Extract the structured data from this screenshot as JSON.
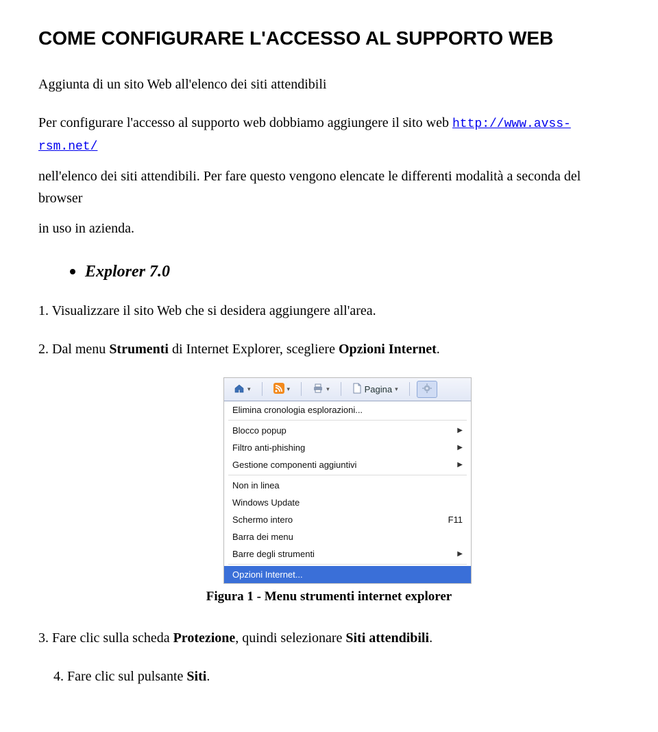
{
  "heading": "COME CONFIGURARE L'ACCESSO AL SUPPORTO WEB",
  "subheading": "Aggiunta di un sito Web all'elenco dei siti attendibili",
  "intro_pre": "Per configurare l'accesso al supporto web dobbiamo aggiungere il sito web ",
  "intro_link": "http://www.avss-rsm.net/",
  "intro_post1": "nell'elenco dei siti attendibili. Per fare questo vengono elencate le differenti modalità a seconda del browser",
  "intro_post2": "in uso in azienda.",
  "bullet": "Explorer 7.0",
  "steps": {
    "s1": "1.   Visualizzare il sito Web che si desidera aggiungere all'area.",
    "s2_pre": "2.   Dal menu ",
    "s2_b1": "Strumenti",
    "s2_mid": " di Internet Explorer, scegliere ",
    "s2_b2": "Opzioni Internet",
    "s2_post": ".",
    "s3_pre": "3.   Fare clic sulla scheda ",
    "s3_b1": "Protezione",
    "s3_mid": ", quindi selezionare ",
    "s3_b2": "Siti attendibili",
    "s3_post": ".",
    "s4_pre": "4.   Fare clic sul pulsante ",
    "s4_b1": "Siti",
    "s4_post": "."
  },
  "caption": "Figura 1 - Menu strumenti internet explorer",
  "shot": {
    "toolbar": {
      "pagina": "Pagina"
    },
    "menu": {
      "m1": "Elimina cronologia esplorazioni...",
      "m2": "Blocco popup",
      "m3": "Filtro anti-phishing",
      "m4": "Gestione componenti aggiuntivi",
      "m5": "Non in linea",
      "m6": "Windows Update",
      "m7": "Schermo intero",
      "m7k": "F11",
      "m8": "Barra dei menu",
      "m9": "Barre degli strumenti",
      "m10": "Opzioni Internet..."
    }
  }
}
